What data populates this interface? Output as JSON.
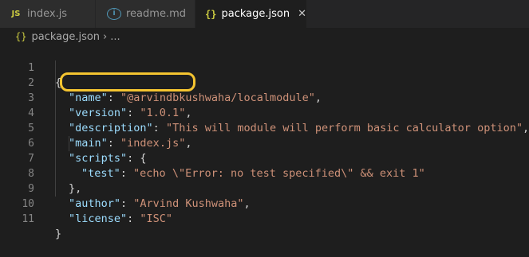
{
  "tabs": [
    {
      "icon": "js-icon",
      "icon_text": "JS",
      "label": "index.js",
      "active": false
    },
    {
      "icon": "info-icon",
      "icon_text": "i",
      "label": "readme.md",
      "active": false
    },
    {
      "icon": "braces-icon",
      "icon_text": "{}",
      "label": "package.json",
      "active": true
    }
  ],
  "close_glyph": "✕",
  "breadcrumb": {
    "icon_text": "{}",
    "file": "package.json",
    "separator": "›",
    "ellipsis": "..."
  },
  "lines": [
    {
      "num": "1",
      "text": "{"
    },
    {
      "num": "2",
      "key": "\"name\"",
      "value": "\"@arvindbkushwaha/localmodule\"",
      "trail": ","
    },
    {
      "num": "3",
      "key": "\"version\"",
      "value": "\"1.0.1\"",
      "trail": ","
    },
    {
      "num": "4",
      "key": "\"description\"",
      "value": "\"This will module will perform basic calculator option\"",
      "trail": ","
    },
    {
      "num": "5",
      "key": "\"main\"",
      "value": "\"index.js\"",
      "trail": ","
    },
    {
      "num": "6",
      "key": "\"scripts\"",
      "value": "",
      "trail": "{"
    },
    {
      "num": "7",
      "key": "\"test\"",
      "value": "\"echo \\\"Error: no test specified\\\" && exit 1\"",
      "trail": ""
    },
    {
      "num": "8",
      "text": "},"
    },
    {
      "num": "9",
      "key": "\"author\"",
      "value": "\"Arvind Kushwaha\"",
      "trail": ","
    },
    {
      "num": "10",
      "key": "\"license\"",
      "value": "\"ISC\"",
      "trail": ""
    },
    {
      "num": "11",
      "text": "}"
    }
  ],
  "colors": {
    "key": "#9cdcfe",
    "string": "#ce9178",
    "highlight": "#f4c430"
  }
}
